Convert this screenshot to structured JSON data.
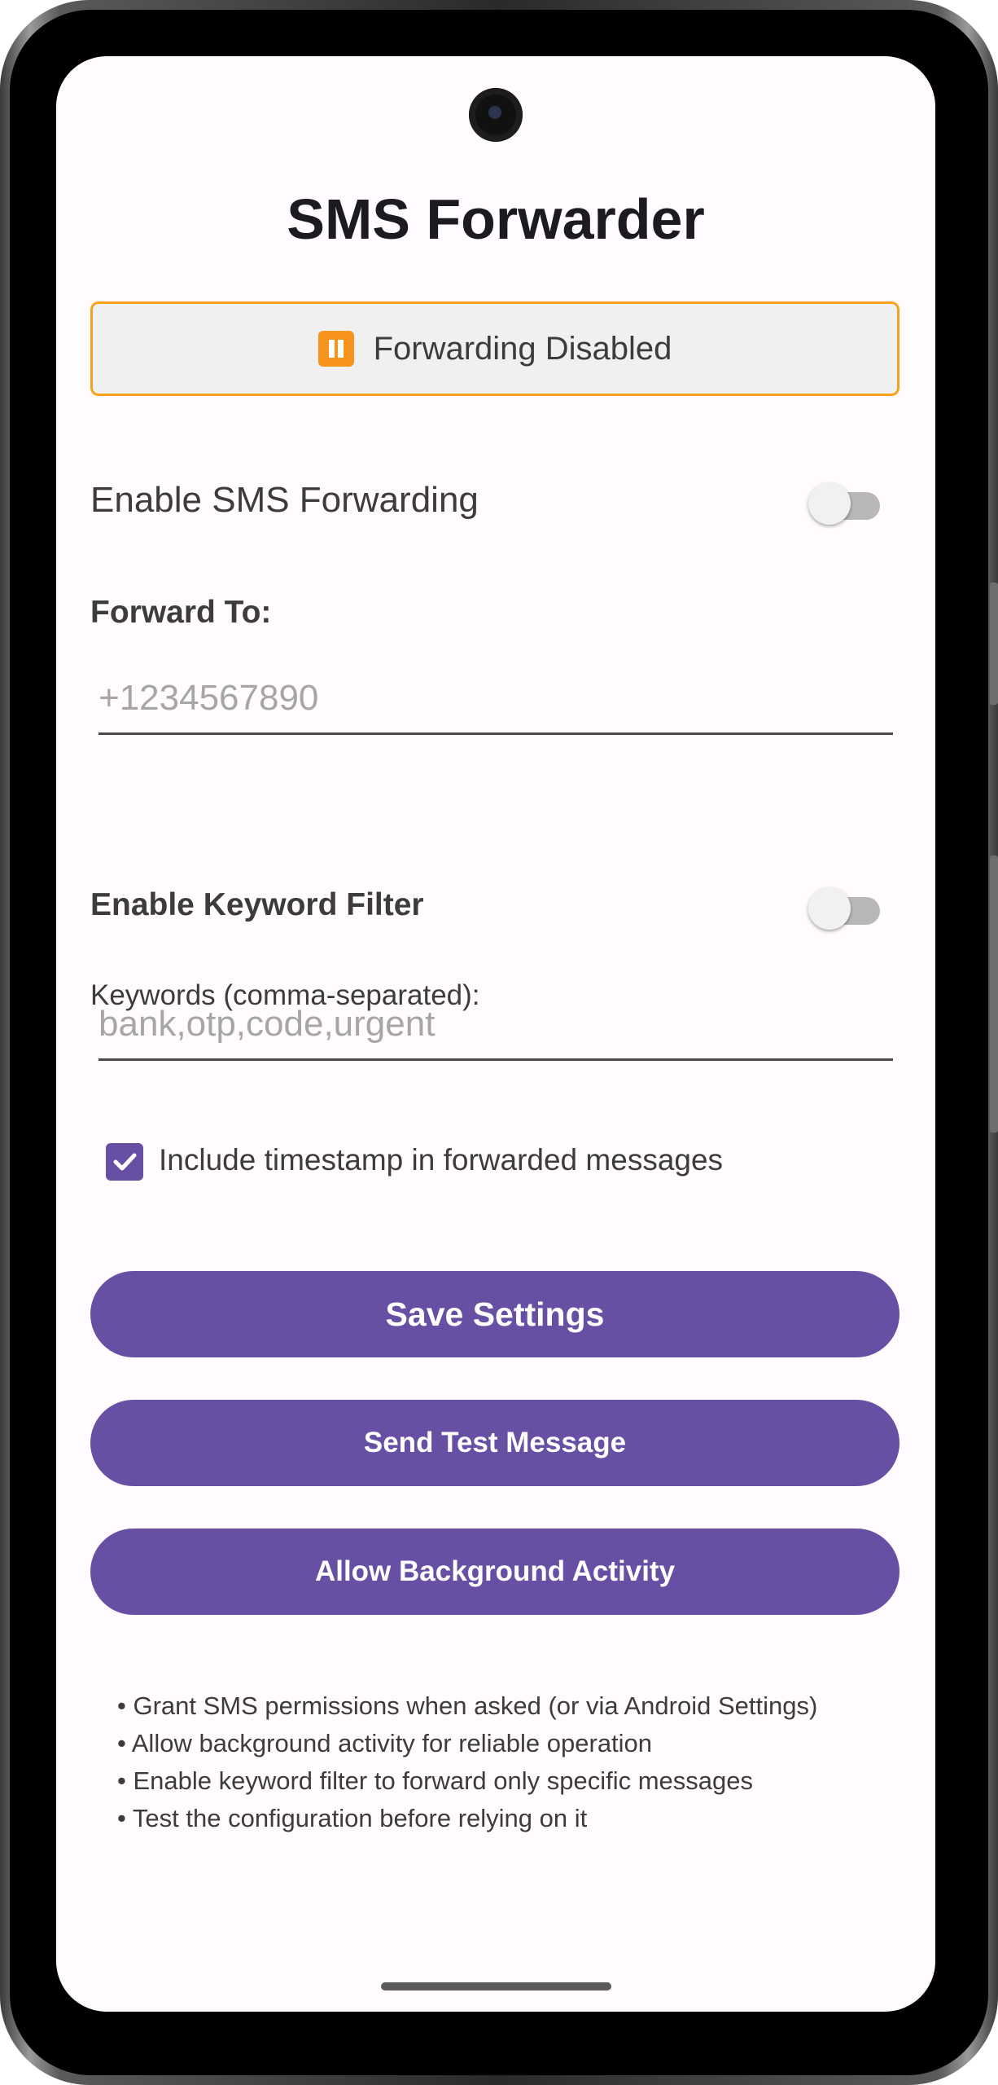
{
  "app": {
    "title": "SMS Forwarder"
  },
  "status": {
    "icon": "pause-icon",
    "text": "Forwarding Disabled",
    "border_color": "#f7a21b",
    "icon_color": "#f7941d"
  },
  "forwarding": {
    "label": "Enable SMS Forwarding",
    "enabled": false
  },
  "forward_to": {
    "label": "Forward To:",
    "placeholder": "+1234567890",
    "value": ""
  },
  "keyword_filter": {
    "label": "Enable Keyword Filter",
    "enabled": false,
    "keywords_label": "Keywords (comma-separated):",
    "keywords_placeholder": "bank,otp,code,urgent",
    "keywords_value": ""
  },
  "timestamp": {
    "label": "Include timestamp in forwarded messages",
    "checked": true
  },
  "buttons": {
    "save": "Save Settings",
    "test": "Send Test Message",
    "background": "Allow Background Activity",
    "color": "#6750a4"
  },
  "tips": [
    "• Grant SMS permissions when asked (or via Android Settings)",
    "• Allow background activity for reliable operation",
    "• Enable keyword filter to forward only specific messages",
    "• Test the configuration before relying on it"
  ]
}
